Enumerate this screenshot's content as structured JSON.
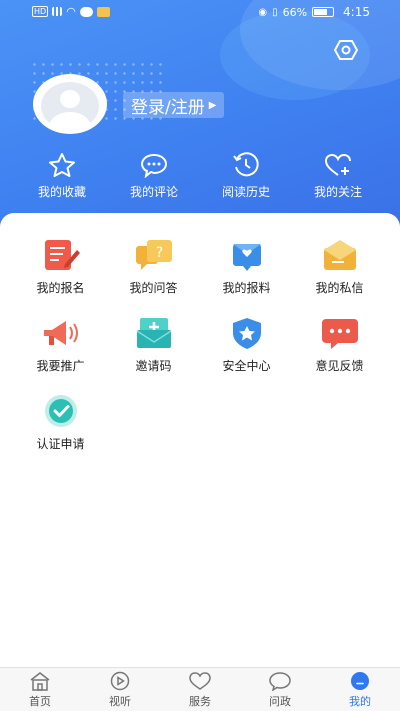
{
  "status_bar": {
    "left_text": "HD",
    "battery": "66%",
    "time": "4:15"
  },
  "profile": {
    "login_label": "登录/注册",
    "settings_icon": "settings-icon"
  },
  "quick_links": [
    {
      "label": "我的收藏",
      "icon": "star-icon"
    },
    {
      "label": "我的评论",
      "icon": "comment-icon"
    },
    {
      "label": "阅读历史",
      "icon": "history-icon"
    },
    {
      "label": "我的关注",
      "icon": "heart-plus-icon"
    }
  ],
  "services": [
    {
      "label": "我的报名",
      "icon": "signup-icon"
    },
    {
      "label": "我的问答",
      "icon": "qa-icon"
    },
    {
      "label": "我的报料",
      "icon": "report-icon"
    },
    {
      "label": "我的私信",
      "icon": "mail-icon"
    },
    {
      "label": "我要推广",
      "icon": "megaphone-icon"
    },
    {
      "label": "邀请码",
      "icon": "invite-icon"
    },
    {
      "label": "安全中心",
      "icon": "shield-icon"
    },
    {
      "label": "意见反馈",
      "icon": "feedback-icon"
    },
    {
      "label": "认证申请",
      "icon": "verify-icon"
    }
  ],
  "tabs": [
    {
      "label": "首页",
      "icon": "home-icon",
      "active": false
    },
    {
      "label": "视听",
      "icon": "play-icon",
      "active": false
    },
    {
      "label": "服务",
      "icon": "heart-icon",
      "active": false
    },
    {
      "label": "问政",
      "icon": "chat-icon",
      "active": false
    },
    {
      "label": "我的",
      "icon": "profile-icon",
      "active": true
    }
  ],
  "colors": {
    "header_blue": "#3f80f0",
    "active_tab": "#2f78ef"
  }
}
